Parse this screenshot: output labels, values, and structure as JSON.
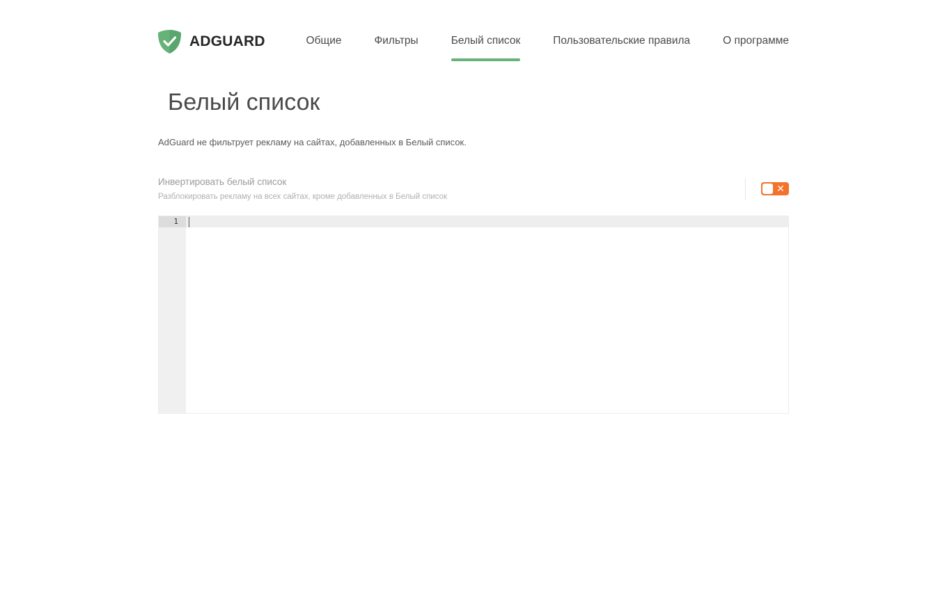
{
  "brand": {
    "name": "ADGUARD",
    "accent_color": "#67b279",
    "toggle_color": "#f4732c"
  },
  "nav": {
    "items": [
      {
        "label": "Общие",
        "active": false
      },
      {
        "label": "Фильтры",
        "active": false
      },
      {
        "label": "Белый список",
        "active": true
      },
      {
        "label": "Пользовательские правила",
        "active": false
      },
      {
        "label": "О программе",
        "active": false
      }
    ]
  },
  "page": {
    "title": "Белый список",
    "description": "AdGuard не фильтрует рекламу на сайтах, добавленных в Белый список."
  },
  "invert_setting": {
    "title": "Инвертировать белый список",
    "description": "Разблокировать рекламу на всех сайтах, кроме добавленных в Белый список",
    "enabled": false,
    "toggle_icon": "close-icon"
  },
  "editor": {
    "line_numbers": [
      "1"
    ],
    "content": ""
  }
}
